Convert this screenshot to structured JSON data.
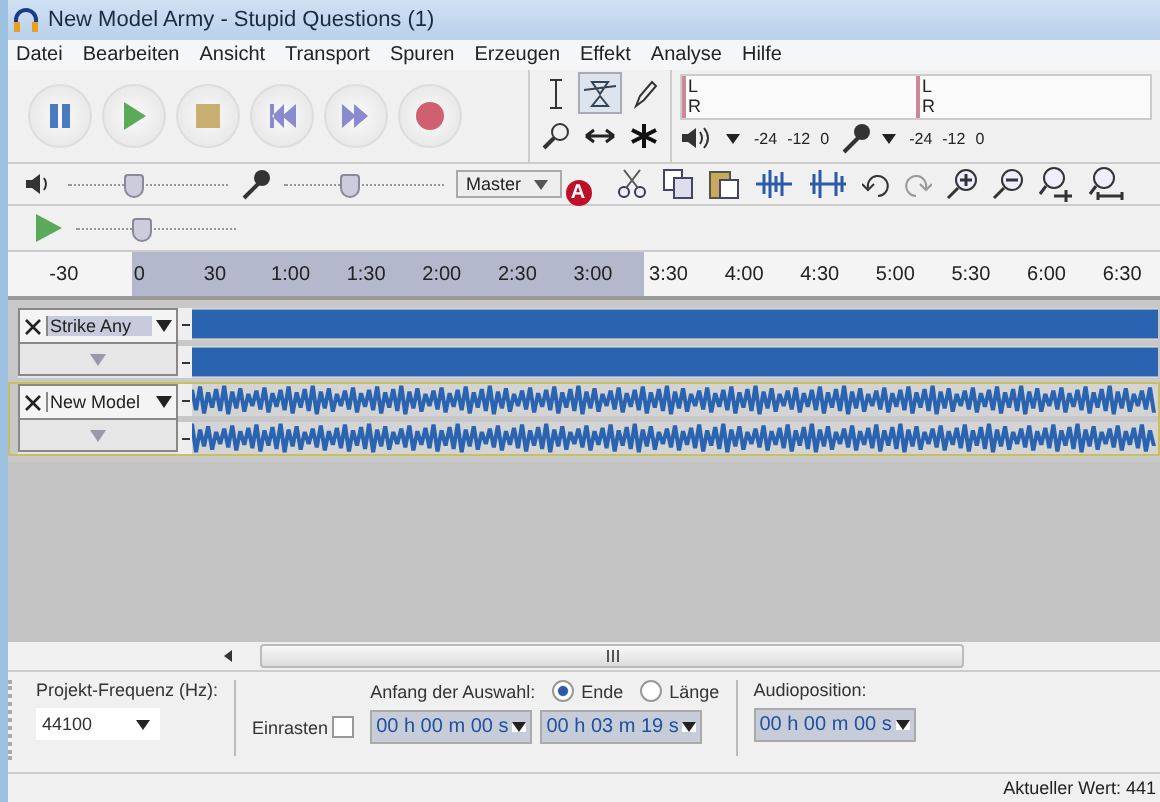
{
  "window": {
    "title": "New Model Army - Stupid Questions (1)"
  },
  "menu": [
    "Datei",
    "Bearbeiten",
    "Ansicht",
    "Transport",
    "Spuren",
    "Erzeugen",
    "Effekt",
    "Analyse",
    "Hilfe"
  ],
  "meters": {
    "channels": [
      "L",
      "R"
    ],
    "playback_channels": [
      "L",
      "R"
    ],
    "playback_scale": [
      "-24",
      "-12",
      "0"
    ],
    "record_scale": [
      "-24",
      "-12",
      "0"
    ]
  },
  "mixer": {
    "output": {
      "level": 0.35
    },
    "input": {
      "level": 0.35
    },
    "source": "Master",
    "marker": "A"
  },
  "play_at_speed": {
    "level": 0.35
  },
  "ruler": {
    "ticks": [
      "-30",
      "0",
      "30",
      "1:00",
      "1:30",
      "2:00",
      "2:30",
      "3:00",
      "3:30",
      "4:00",
      "4:30",
      "5:00",
      "5:30",
      "6:00",
      "6:30"
    ]
  },
  "tracks": [
    {
      "name": "Strike Any",
      "kind": "early",
      "selected": true
    },
    {
      "name": "New Model",
      "kind": "late",
      "selected": false
    }
  ],
  "selection_bar": {
    "rate_label": "Projekt-Frequenz (Hz):",
    "rate": "44100",
    "snap_label": "Einrasten",
    "snap_checked": false,
    "start_label": "Anfang der Auswahl:",
    "start": "00 h 00 m 00 s",
    "modes": [
      {
        "label": "Ende",
        "selected": true
      },
      {
        "label": "Länge",
        "selected": false
      }
    ],
    "end": "00 h 03 m 19 s",
    "position_label": "Audioposition:",
    "position": "00 h 00 m 00 s"
  },
  "status_bar": "Aktueller Wert: 441"
}
